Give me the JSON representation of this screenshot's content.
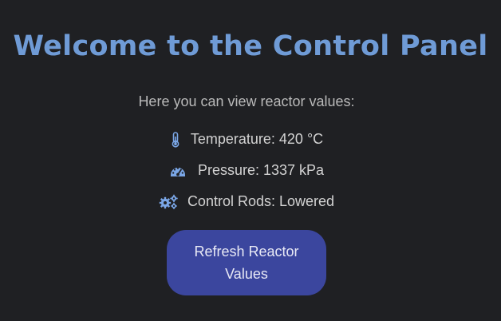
{
  "header": {
    "title": "Welcome to the Control Panel"
  },
  "main": {
    "intro": "Here you can view reactor values:",
    "readings": [
      {
        "icon": "thermometer-icon",
        "text": "Temperature: 420 °C"
      },
      {
        "icon": "gauge-icon",
        "text": "Pressure: 1337 kPa"
      },
      {
        "icon": "gears-icon",
        "text": "Control Rods: Lowered"
      }
    ],
    "refresh_label": "Refresh Reactor Values"
  },
  "colors": {
    "background": "#1f2023",
    "title": "#6f9bd6",
    "icon": "#7aa6e6",
    "button": "#3b469e"
  }
}
